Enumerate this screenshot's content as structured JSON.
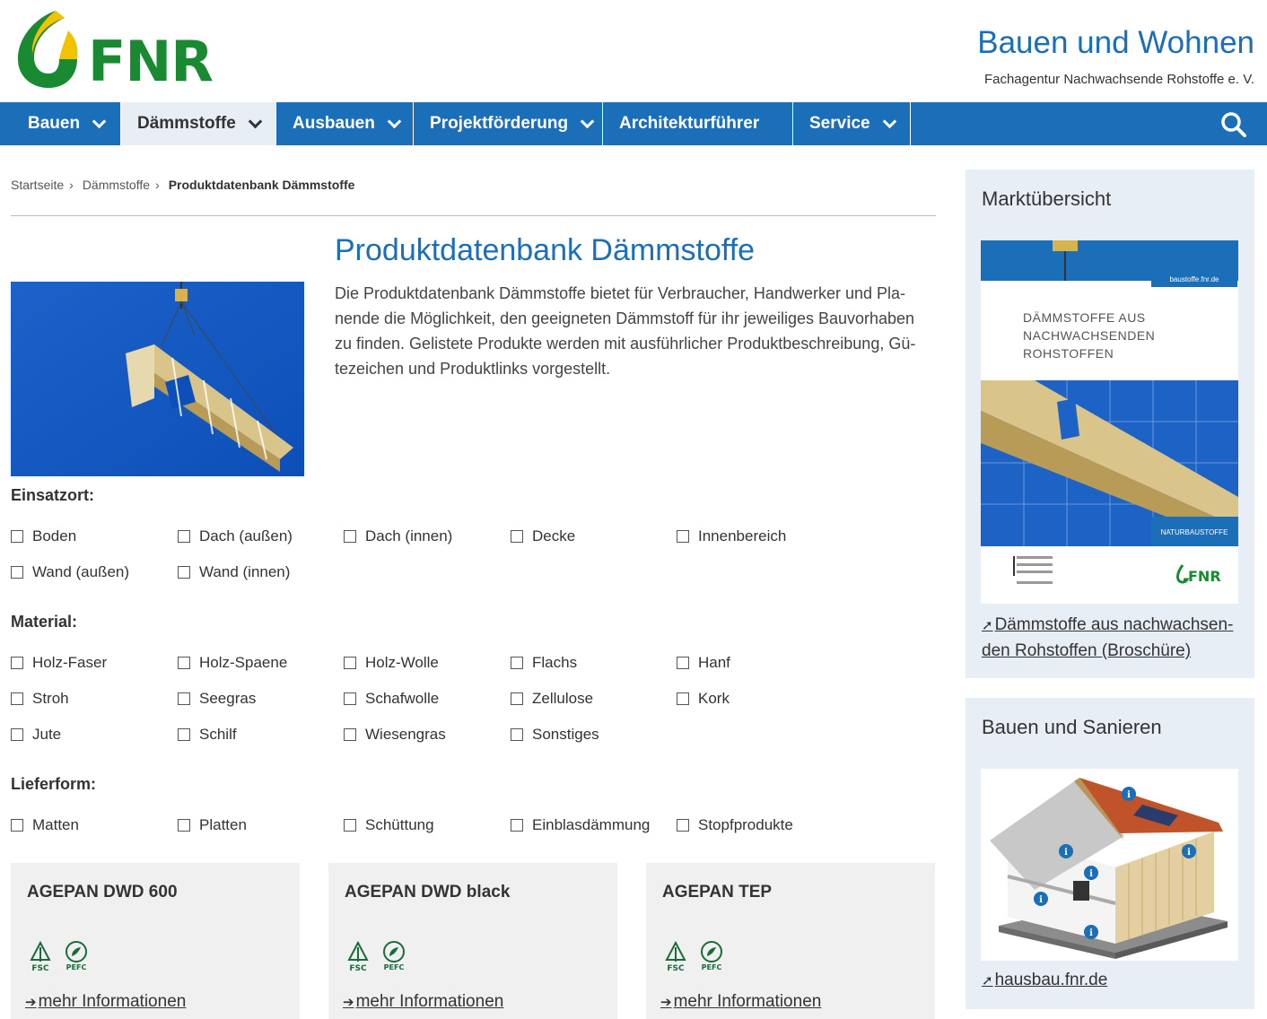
{
  "header": {
    "logo_text": "FNR",
    "site_title": "Bauen und Wohnen",
    "site_subtitle": "Fachagentur Nachwachsende Rohstoffe e. V."
  },
  "nav": {
    "items": [
      {
        "label": "Bauen",
        "dropdown": true
      },
      {
        "label": "Dämmstoffe",
        "dropdown": true,
        "active": true
      },
      {
        "label": "Ausbauen",
        "dropdown": true
      },
      {
        "label": "Projektförderung",
        "dropdown": true
      },
      {
        "label": "Architekturführer",
        "dropdown": false
      },
      {
        "label": "Service",
        "dropdown": true
      }
    ],
    "search_icon": "search-icon"
  },
  "breadcrumb": [
    "Startseite",
    "Dämmstoffe",
    "Produktdatenbank Dämmstoffe"
  ],
  "main": {
    "title": "Produktdatenbank Dämmstoffe",
    "intro": "Die Produktdatenbank Dämmstoffe bietet für Verbraucher, Handwerker und Pla­nende die Möglichkeit, den geeigneten Dämmstoff für ihr jeweiliges Bauvorhaben zu finden. Gelistete Produkte werden mit ausführlicher Produktbeschreibung, Gü­tezeichen und Produktlinks vorgestellt."
  },
  "filters": {
    "einsatzort": {
      "label": "Einsatzort:",
      "options": [
        "Boden",
        "Dach (außen)",
        "Dach (innen)",
        "Decke",
        "Innenbereich",
        "Wand (außen)",
        "Wand (innen)"
      ]
    },
    "material": {
      "label": "Material:",
      "options": [
        "Holz-Faser",
        "Holz-Spaene",
        "Holz-Wolle",
        "Flachs",
        "Hanf",
        "Stroh",
        "Seegras",
        "Schafwolle",
        "Zellulose",
        "Kork",
        "Jute",
        "Schilf",
        "Wiesengras",
        "Sonstiges"
      ]
    },
    "lieferform": {
      "label": "Lieferform:",
      "options": [
        "Matten",
        "Platten",
        "Schüttung",
        "Einblasdämmung",
        "Stopfprodukte"
      ]
    }
  },
  "products": [
    {
      "name": "AGEPAN DWD 600",
      "link": "mehr Informationen",
      "certs": [
        "FSC",
        "PEFC"
      ]
    },
    {
      "name": "AGEPAN DWD black",
      "link": "mehr Informationen",
      "certs": [
        "FSC",
        "PEFC"
      ]
    },
    {
      "name": "AGEPAN TEP",
      "link": "mehr Informationen",
      "certs": [
        "FSC",
        "PEFC"
      ]
    }
  ],
  "sidebar": {
    "box1": {
      "title": "Marktübersicht",
      "brochure_url_tag": "baustoffe.fnr.de",
      "brochure_heading": [
        "DÄMMSTOFFE AUS",
        "NACHWACHSENDEN",
        "ROHSTOFFEN"
      ],
      "brochure_tag": "NATURBAUSTOFFE",
      "brochure_logo": "FNR",
      "link": "Dämmstoffe aus nachwachsen­den Rohstoffen (Broschüre)"
    },
    "box2": {
      "title": "Bauen und Sanieren",
      "link": "hausbau.fnr.de"
    }
  },
  "colors": {
    "brand_blue": "#1b6eb8",
    "brand_green": "#1a8a32",
    "brand_yellow": "#f2c200",
    "sidebar_bg": "#e7eef6",
    "card_bg": "#f0f0f0"
  }
}
